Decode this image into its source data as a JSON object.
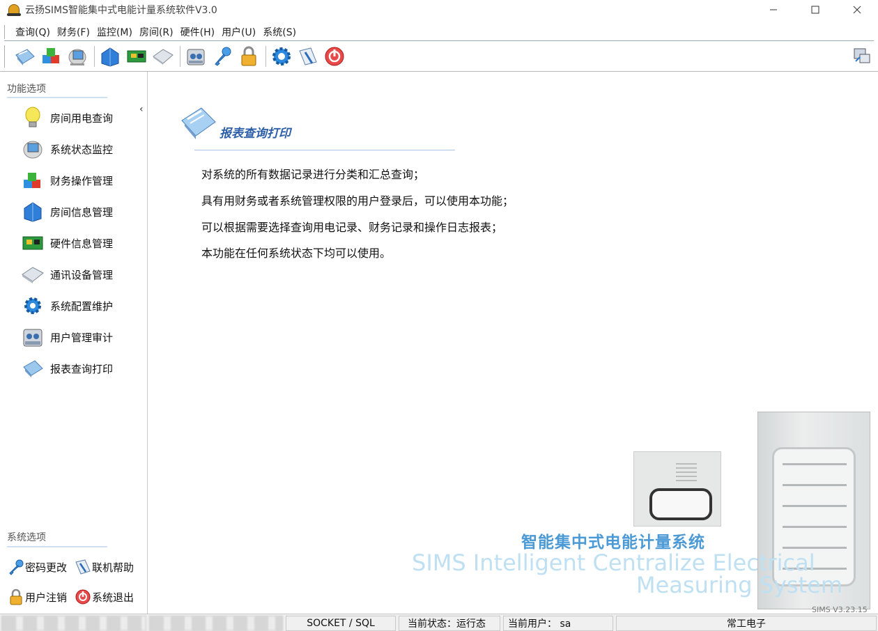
{
  "window": {
    "title": "云扬SIMS智能集中式电能计量系统软件V3.0"
  },
  "menu": [
    "查询(Q)",
    "财务(F)",
    "监控(M)",
    "房间(R)",
    "硬件(H)",
    "用户(U)",
    "系统(S)"
  ],
  "toolbar": {
    "groups": [
      [
        "report-icon",
        "finance-icon",
        "monitor-icon"
      ],
      [
        "room-icon",
        "hardware-icon",
        "comm-device-icon"
      ],
      [
        "user-audit-icon",
        "password-key-icon",
        "logout-lock-icon"
      ],
      [
        "config-gear-icon",
        "help-icon",
        "exit-icon"
      ]
    ],
    "right_icon": "network-status-icon"
  },
  "sidebar": {
    "section_title": "功能选项",
    "items": [
      {
        "label": "房间用电查询",
        "icon": "bulb-icon"
      },
      {
        "label": "系统状态监控",
        "icon": "monitor-icon"
      },
      {
        "label": "财务操作管理",
        "icon": "finance-icon"
      },
      {
        "label": "房间信息管理",
        "icon": "room-icon"
      },
      {
        "label": "硬件信息管理",
        "icon": "hardware-icon"
      },
      {
        "label": "通讯设备管理",
        "icon": "comm-device-icon"
      },
      {
        "label": "系统配置维护",
        "icon": "config-gear-icon"
      },
      {
        "label": "用户管理审计",
        "icon": "user-audit-icon"
      },
      {
        "label": "报表查询打印",
        "icon": "report-icon"
      }
    ],
    "system_title": "系统选项",
    "system_items": [
      {
        "label": "密码更改",
        "icon": "password-key-icon"
      },
      {
        "label": "联机帮助",
        "icon": "help-icon"
      },
      {
        "label": "用户注销",
        "icon": "logout-lock-icon"
      },
      {
        "label": "系统退出",
        "icon": "exit-icon"
      }
    ]
  },
  "content": {
    "heading": "报表查询打印",
    "lines": [
      "对系统的所有数据记录进行分类和汇总查询；",
      "具有用财务或者系统管理权限的用户登录后，可以使用本功能；",
      "可以根据需要选择查询用电记录、财务记录和操作日志报表；",
      "本功能在任何系统状态下均可以使用。"
    ],
    "watermark_cn": "智能集中式电能计量系统",
    "watermark_en_1": "SIMS Intelligent Centralize Electrical",
    "watermark_en_2": "Measuring System",
    "version": "SIMS V3.23.15"
  },
  "status": {
    "protocol": "SOCKET / SQL",
    "state": "当前状态：运行态",
    "user": "当前用户： sa",
    "company": "常工电子"
  },
  "colors": {
    "heading": "#2c5fa8",
    "watermark_cn": "#4b9ad6",
    "watermark_en": "#bfe0f2"
  }
}
